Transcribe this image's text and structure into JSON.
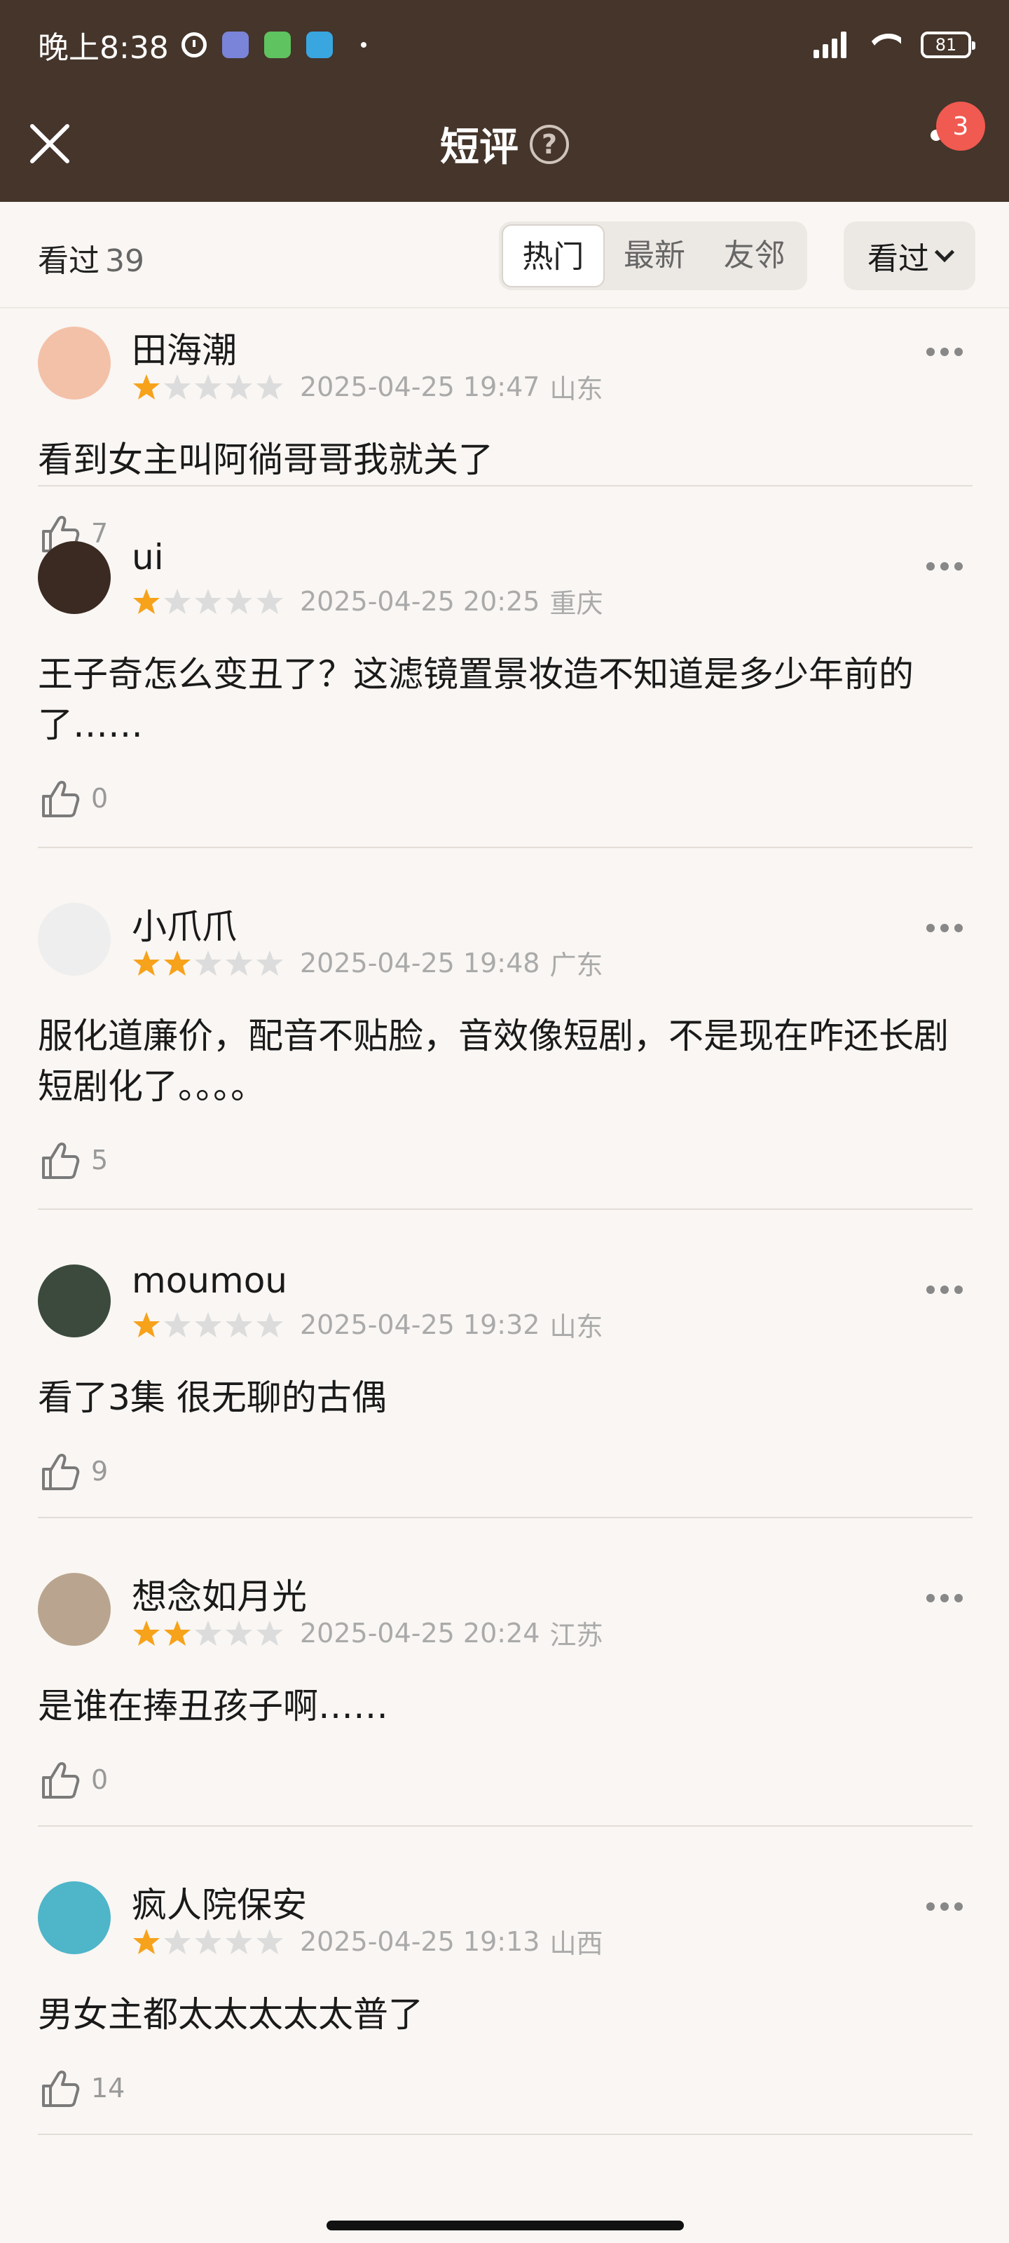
{
  "status_bar": {
    "time": "晚上8:38",
    "battery": "81"
  },
  "header": {
    "title": "短评",
    "help_icon": "?",
    "notification_count": "3"
  },
  "filter": {
    "seen_label": "看过",
    "seen_count": "39",
    "tabs": [
      "热门",
      "最新",
      "友邻"
    ],
    "active_tab": "热门",
    "dropdown_label": "看过"
  },
  "colors": {
    "header_bg": "#45352b",
    "star_on": "#f7a21b",
    "star_off": "#dcdcdc",
    "badge": "#f05a50"
  },
  "comments": [
    {
      "user": "田海潮",
      "rating": 1,
      "date": "2025-04-25 19:47",
      "region": "山东",
      "text": "看到女主叫阿徜哥哥我就关了",
      "likes": "7"
    },
    {
      "user": "ui",
      "rating": 1,
      "date": "2025-04-25 20:25",
      "region": "重庆",
      "text": "王子奇怎么变丑了？这滤镜置景妆造不知道是多少年前的了……",
      "likes": "0"
    },
    {
      "user": "小爪爪",
      "rating": 2,
      "date": "2025-04-25 19:48",
      "region": "广东",
      "text": "服化道廉价，配音不贴脸，音效像短剧，不是现在咋还长剧短剧化了。。。。",
      "likes": "5"
    },
    {
      "user": "moumou",
      "rating": 1,
      "date": "2025-04-25 19:32",
      "region": "山东",
      "text": "看了3集 很无聊的古偶",
      "likes": "9"
    },
    {
      "user": "想念如月光",
      "rating": 2,
      "date": "2025-04-25 20:24",
      "region": "江苏",
      "text": "是谁在捧丑孩子啊……",
      "likes": "0"
    },
    {
      "user": "疯人院保安",
      "rating": 1,
      "date": "2025-04-25 19:13",
      "region": "山西",
      "text": "男女主都太太太太太普了",
      "likes": "14"
    }
  ]
}
